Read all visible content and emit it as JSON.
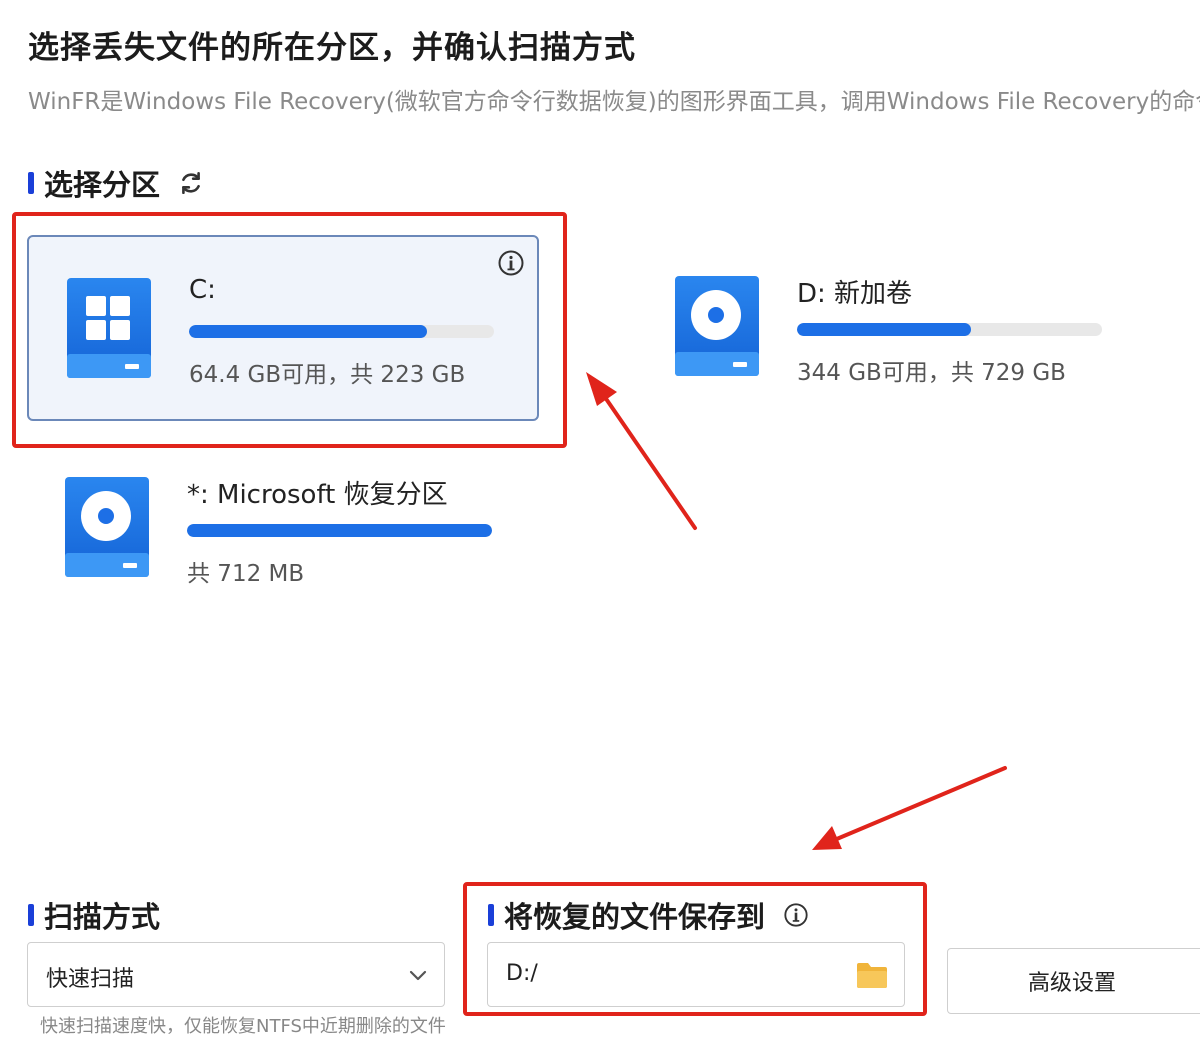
{
  "header": {
    "title": "选择丢失文件的所在分区，并确认扫描方式",
    "subtitle": "WinFR是Windows File Recovery(微软官方命令行数据恢复)的图形界面工具，调用Windows File Recovery的命令"
  },
  "partitions": {
    "heading": "选择分区",
    "refresh_icon": "refresh-icon",
    "items": [
      {
        "name": "C:",
        "usage": "64.4 GB可用，共 223 GB",
        "used_fraction": 0.78,
        "icon": "windows-drive-icon",
        "selected": true
      },
      {
        "name": "D: 新加卷",
        "usage": "344 GB可用，共 729 GB",
        "used_fraction": 0.57,
        "icon": "disk-drive-icon",
        "selected": false
      },
      {
        "name": "*: Microsoft 恢复分区",
        "usage": "共 712 MB",
        "used_fraction": 1.0,
        "icon": "disk-drive-icon",
        "selected": false
      }
    ]
  },
  "scan": {
    "heading": "扫描方式",
    "selected": "快速扫描",
    "hint_partial": "快速扫描速度快，仅能恢复NTFS中近期删除的文件"
  },
  "save": {
    "heading": "将恢复的文件保存到",
    "path": "D:/"
  },
  "advanced": {
    "label": "高级设置"
  },
  "colors": {
    "accent": "#1a3fd8",
    "progress": "#1d6fe6",
    "annotation": "#e0241b",
    "folder": "#f5c04a"
  }
}
